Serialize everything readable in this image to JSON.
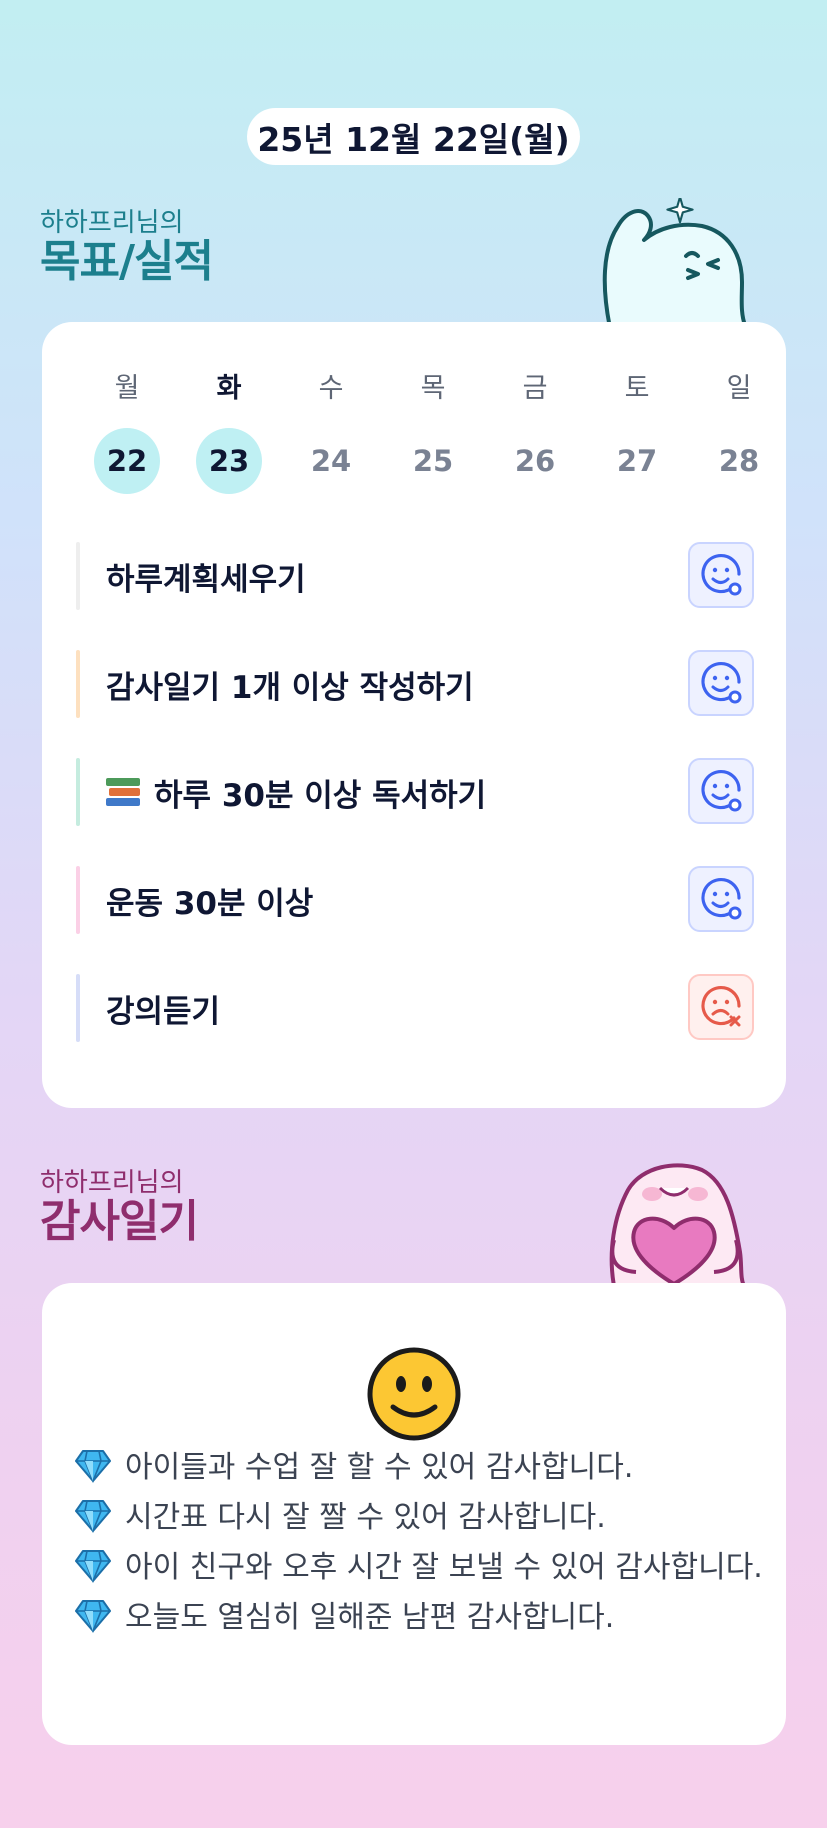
{
  "date_label": "25년 12월 22일(월)",
  "goals_section": {
    "subtitle": "하하프리님의",
    "title": "목표/실적"
  },
  "calendar": {
    "days": [
      {
        "name": "월",
        "num": "22",
        "active": true,
        "today": false
      },
      {
        "name": "화",
        "num": "23",
        "active": true,
        "today": true
      },
      {
        "name": "수",
        "num": "24",
        "active": false,
        "today": false
      },
      {
        "name": "목",
        "num": "25",
        "active": false,
        "today": false
      },
      {
        "name": "금",
        "num": "26",
        "active": false,
        "today": false
      },
      {
        "name": "토",
        "num": "27",
        "active": false,
        "today": false
      },
      {
        "name": "일",
        "num": "28",
        "active": false,
        "today": false
      }
    ]
  },
  "tasks": [
    {
      "label": "하루계획세우기",
      "bar_color": "#eeeeee",
      "status": "done",
      "icon": "smile-check-icon"
    },
    {
      "label": "감사일기 1개 이상 작성하기",
      "bar_color": "#fde0bf",
      "status": "done",
      "icon": "smile-check-icon"
    },
    {
      "label": "하루 30분 이상 독서하기",
      "prefix_icon": "books-emoji-icon",
      "bar_color": "#c5ecdf",
      "status": "done",
      "icon": "smile-check-icon"
    },
    {
      "label": "운동 30분 이상",
      "bar_color": "#fbd0e6",
      "status": "done",
      "icon": "smile-check-icon"
    },
    {
      "label": "강의듣기",
      "bar_color": "#d6ddf8",
      "status": "fail",
      "icon": "sad-x-icon"
    }
  ],
  "thanks_section": {
    "subtitle": "하하프리님의",
    "title": "감사일기"
  },
  "thanks_entries": [
    "아이들과 수업 잘 할 수 있어 감사합니다.",
    "시간표 다시 잘 짤 수 있어 감사합니다.",
    "아이 친구와 오후 시간 잘 보낼 수 있어 감사합니다.",
    "오늘도 열심히 일해준 남편 감사합니다."
  ],
  "colors": {
    "done_accent": "#3d63f0",
    "fail_accent": "#e65a4a",
    "goals_title": "#1c7f8d",
    "thanks_title": "#8f2d6d"
  }
}
